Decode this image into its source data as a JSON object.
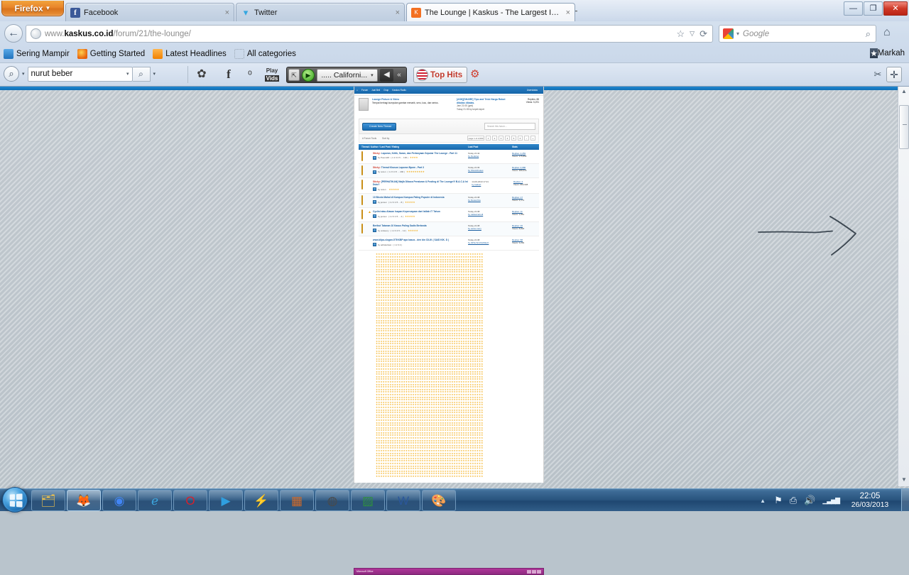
{
  "window": {
    "firefox_button": "Firefox",
    "controls": {
      "minimize": "—",
      "maximize": "❐",
      "close": "✕"
    }
  },
  "tabs": [
    {
      "label": "Facebook",
      "favicon": "facebook-icon",
      "favicon_text": "f",
      "close": "×",
      "active": false
    },
    {
      "label": "Twitter",
      "favicon": "twitter-icon",
      "favicon_text": "ᵒ",
      "close": "×",
      "active": false
    },
    {
      "label": "The Lounge | Kaskus - The Largest In...",
      "favicon": "kaskus-icon",
      "favicon_text": "K",
      "close": "×",
      "active": true
    }
  ],
  "newtab_label": "+",
  "navbar": {
    "back_icon": "←",
    "url_prefix": "www.",
    "url_domain": "kaskus.co.id",
    "url_path": "/forum/21/the-lounge/",
    "bookmark_star_icon": "☆",
    "dropmarker_icon": "▽",
    "reload_icon": "⟳",
    "search_engine": "Google",
    "search_placeholder": "Google",
    "search_go_icon": "⌕",
    "home_icon": "⌂"
  },
  "bookmarks": {
    "items": [
      {
        "label": "Sering Mampir",
        "icon": "bookmark-icon"
      },
      {
        "label": "Getting Started",
        "icon": "firefox-icon"
      },
      {
        "label": "Latest Headlines",
        "icon": "rss-icon"
      },
      {
        "label": "All categories",
        "icon": "folder-icon"
      }
    ],
    "right_label": "Markah",
    "right_icon": "star-box-icon"
  },
  "addon_toolbar": {
    "search_value": "nurut beber",
    "search_icon": "magnifier-icon",
    "go_icon": "magnifier-icon",
    "dropdown_caret": "▾",
    "icons": [
      {
        "name": "settings-gear-icon",
        "glyph": "✿"
      },
      {
        "name": "facebook-icon",
        "glyph": "f"
      },
      {
        "name": "twitter-icon",
        "glyph": "ᵒ"
      },
      {
        "name": "playvids-icon",
        "glyph": "Play"
      }
    ],
    "media": {
      "popout_icon": "⇱",
      "play_icon": "▶",
      "station": "..... Californi...",
      "station_caret": "▾",
      "volume_icon": "◀",
      "collapse_icon": "«"
    },
    "top_hits_label": "Top Hits",
    "top_hits_icon": "usa-flag-icon",
    "gift_icon": "🎁",
    "wrench_icon": "🔧",
    "plus_icon": "✛"
  },
  "page": {
    "nav": {
      "home_icon": "⌂",
      "items": [
        "Forum",
        "Jual Beli",
        "Grup",
        "Kaskus Radio"
      ],
      "right_user": "Userstatus",
      "right_icons": [
        "edit-icon",
        "settings-icon"
      ]
    },
    "sticky_thread": {
      "title": "Lounge Picture & Video",
      "desc": "Tempat berbagi kumpulan gambar menarik, seru, lucu, dan serius.",
      "last_title": "[ASK][SHARE] Tips and Trick Harga Robot dibalas dibalas.",
      "last_by": "Jam 21:05 (gmt)",
      "last_date": "Today 21:05 by kepet.kepet",
      "replies": "Replies: 88",
      "views": "Views: 5,291"
    },
    "actions": {
      "new_thread": "Create New Thread",
      "new_thread_icon": "pencil-icon",
      "search_placeholder": "Search this forum...",
      "search_icon": "magnifier-icon"
    },
    "subbar": {
      "tools": "# Forum Tools",
      "sort": "Sort by",
      "pager_label": "page 1 of 2,000",
      "pages": [
        "1",
        "2",
        "3",
        "4",
        "5",
        "6",
        "›",
        "»"
      ]
    },
    "table_headers": {
      "thread": "Thread / Author / Last Post / Rating",
      "last_post": "Last Post",
      "stats": "Stats"
    },
    "threads": [
      {
        "sticky": "Sticky:",
        "title": "Laporan, Kritik, Saran, dan Pertanyaan Seputar The Lounge - Part 11",
        "author": "by PoemsID",
        "pages": "( 1 2 3 4 5 ... 100 )",
        "stars": "★★★★",
        "last_time": "Today 21:42",
        "last_by": "by Dedeloq",
        "replies": "Replies: 2,281",
        "views": "Views: 175,892",
        "badge": true,
        "warn": false
      },
      {
        "sticky": "Sticky:",
        "title": "Thread Khusus Laporan Bpom - Part 3",
        "author": "by rezen",
        "pages": "( 1 2 3 4 5 ... 200 )",
        "stars": "★★★★★★★★★",
        "last_time": "Today 21:36",
        "last_by": "by ShowViruses",
        "replies": "Replies: 4,980",
        "views": "Views: 388,516",
        "badge": true,
        "warn": false
      },
      {
        "sticky": "Sticky:",
        "title": "[PERHATIKAN] Wajib Dibaca Peraturan & Posting di The Lounge!!! B.A.C.A Ini Dulu!!",
        "author": "by rezen",
        "pages": "",
        "stars": "★★★★★",
        "last_time": "14-03-2013 17:21",
        "last_by": "by Gaburi",
        "replies": "Replies: 2",
        "views": "Views: 883,908",
        "badge": true,
        "warn": false
      },
      {
        "sticky": "",
        "title": "10 Bisnis Mahal di Kampus Kampus Paling Populer di Indonesia",
        "author": "by jensun",
        "pages": "( 1 2 3 4 5 ... 8 )",
        "stars": "★★★★★",
        "last_time": "Today 21:38",
        "last_by": "by Dewa.Kita",
        "replies": "Replies: 17",
        "views": "Views: 2,173",
        "badge": true,
        "warn": false
      },
      {
        "sticky": "",
        "title": "Cyclist atau Alasan Isapan Kepercayaan dari Istilah IT Tahun",
        "author": "by jensun",
        "pages": "( 1 2 3 4 5 ... 4 )",
        "stars": "★★★★★",
        "last_time": "Today 21:38",
        "last_by": "by sakaamarodi",
        "replies": "Replies: 11",
        "views": "Views: 1,881",
        "badge": true,
        "warn": true
      },
      {
        "sticky": "",
        "title": "Berikut Tatanan 10 Kasus Paling Sadis Berlanda",
        "author": "by ondeecy",
        "pages": "( 1 2 3 4 5 ... 12 )",
        "stars": "★★★★★",
        "last_time": "Today 21:38",
        "last_by": "by setuu.mery",
        "replies": "Replies: 20",
        "views": "Views: 8,818",
        "badge": true,
        "warn": false
      },
      {
        "sticky": "",
        "title": "www.kilpa-slogan.GTKKBP apa kasus - den bin CILIK ( SAID KIK. D )",
        "author": "by adriatulisan",
        "pages": "( 1 2 3 4 )",
        "stars": "",
        "last_time": "Today 21:38",
        "last_by": "by k9TechnicNotMuch",
        "replies": "Replies: 88",
        "views": "Views: 3,299",
        "badge": false,
        "warn": false
      }
    ],
    "star_flood_char": "★",
    "star_flood_count": 6200
  },
  "background_window": {
    "title": "Microsoft Office",
    "controls": [
      "—",
      "❐",
      "✕"
    ]
  },
  "scrollbar": {
    "up_icon": "▲",
    "down_icon": "▼"
  },
  "annotation": {
    "type": "hand-drawn-arrow",
    "color": "#3d4852",
    "direction": "right"
  },
  "taskbar": {
    "start_label": "Start",
    "items": [
      {
        "name": "windows-explorer-icon",
        "glyph": "🗂"
      },
      {
        "name": "firefox-icon",
        "glyph": "🦊"
      },
      {
        "name": "chrome-icon",
        "glyph": "◉"
      },
      {
        "name": "internet-explorer-icon",
        "glyph": "ℯ"
      },
      {
        "name": "opera-icon",
        "glyph": "O"
      },
      {
        "name": "media-player-icon",
        "glyph": "▶"
      },
      {
        "name": "flashget-icon",
        "glyph": "⚡"
      },
      {
        "name": "photo-viewer-icon",
        "glyph": "▦"
      },
      {
        "name": "video-converter-icon",
        "glyph": "◍"
      },
      {
        "name": "system-monitor-icon",
        "glyph": "▨"
      },
      {
        "name": "microsoft-word-icon",
        "glyph": "W"
      },
      {
        "name": "paint-icon",
        "glyph": "🎨"
      }
    ],
    "tray": {
      "expand_icon": "▲",
      "icons": [
        {
          "name": "action-center-flag-icon",
          "glyph": "⚑"
        },
        {
          "name": "safely-remove-icon",
          "glyph": "⎙"
        },
        {
          "name": "volume-icon",
          "glyph": "🔊"
        },
        {
          "name": "network-signal-icon",
          "glyph": "▮"
        }
      ],
      "time": "22:05",
      "date": "26/03/2013"
    }
  }
}
